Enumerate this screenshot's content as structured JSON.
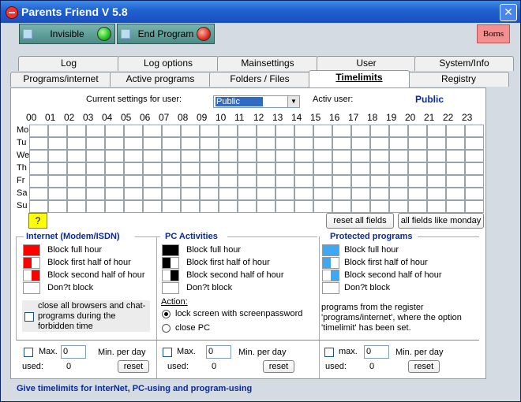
{
  "window": {
    "title": "Parents Friend V 5.8",
    "close_glyph": "✕"
  },
  "toolbar": {
    "invisible_label": "Invisible",
    "end_program_label": "End Program",
    "borns_label": "Borns"
  },
  "tabs_row1": [
    "Log",
    "Log options",
    "Mainsettings",
    "User",
    "System/Info"
  ],
  "tabs_row2": [
    "Programs/internet",
    "Active programs",
    "Folders / Files",
    "Timelimits",
    "Registry"
  ],
  "active_tab": "Timelimits",
  "settings": {
    "label": "Current settings for user:",
    "selected_user": "Public",
    "activ_label": "Activ user:",
    "activ_user": "Public"
  },
  "hours": [
    "00",
    "01",
    "02",
    "03",
    "04",
    "05",
    "06",
    "07",
    "08",
    "09",
    "10",
    "11",
    "12",
    "13",
    "14",
    "15",
    "16",
    "17",
    "18",
    "19",
    "20",
    "21",
    "22",
    "23"
  ],
  "days": [
    "Mo",
    "Tu",
    "We",
    "Th",
    "Fr",
    "Sa",
    "Su"
  ],
  "buttons": {
    "help": "?",
    "reset_all": "reset all fields",
    "like_monday": "all fields like monday"
  },
  "internet": {
    "title": "Internet (Modem/ISDN)",
    "block_full": "Block full hour",
    "block_first": "Block first half of hour",
    "block_second": "Block second half of hour",
    "dont_block": "Don?t block",
    "close_browsers": "close all browsers and chat-programs during the forbidden time",
    "color": "#ff0000"
  },
  "pc": {
    "title": "PC Activities",
    "block_full": "Block full hour",
    "block_first": "Block first half of hour",
    "block_second": "Block second half of hour",
    "dont_block": "Don?t block",
    "action_label": "Action:",
    "lock_screen": "lock screen with screenpassword",
    "close_pc": "close PC",
    "color": "#000000"
  },
  "protected": {
    "title": "Protected programs",
    "block_full": "Block full hour",
    "block_first": "Block first half of hour",
    "block_second": "Block second half of hour",
    "dont_block": "Don?t block",
    "description": [
      "programs from the register",
      "'programs/internet', where the option",
      "'timelimit' has been set."
    ],
    "color": "#3fa8f4"
  },
  "limits": {
    "max_label_a": "Max.",
    "max_label_c": "max.",
    "value": "0",
    "per_day": "Min. per day",
    "used_label": "used:",
    "used_value": "0",
    "reset_label": "reset"
  },
  "status_text": "Give timelimits for InterNet, PC-using and program-using"
}
